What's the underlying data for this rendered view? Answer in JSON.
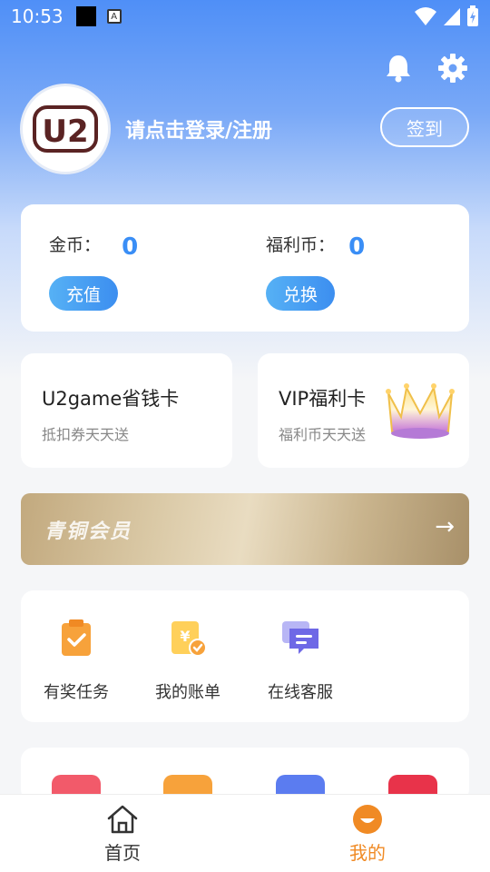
{
  "status_bar": {
    "time": "10:53"
  },
  "profile": {
    "login_text": "请点击登录/注册",
    "checkin_label": "签到",
    "avatar_text": "U2"
  },
  "wallet": {
    "coin_label": "金币：",
    "coin_value": "0",
    "recharge_label": "充值",
    "welfare_label": "福利币：",
    "welfare_value": "0",
    "exchange_label": "兑换"
  },
  "cards": {
    "save_card_title": "U2game省钱卡",
    "save_card_sub": "抵扣券天天送",
    "vip_card_title": "VIP福利卡",
    "vip_card_sub": "福利币天天送"
  },
  "banner": {
    "label": "青铜会员",
    "arrow": "→"
  },
  "tools": [
    {
      "label": "有奖任务",
      "icon": "clipboard-check-icon"
    },
    {
      "label": "我的账单",
      "icon": "yuan-bill-icon"
    },
    {
      "label": "在线客服",
      "icon": "chat-service-icon"
    }
  ],
  "nav": {
    "home_label": "首页",
    "mine_label": "我的"
  },
  "colors": {
    "accent_blue": "#3a8ef6",
    "accent_orange": "#f08a24"
  }
}
